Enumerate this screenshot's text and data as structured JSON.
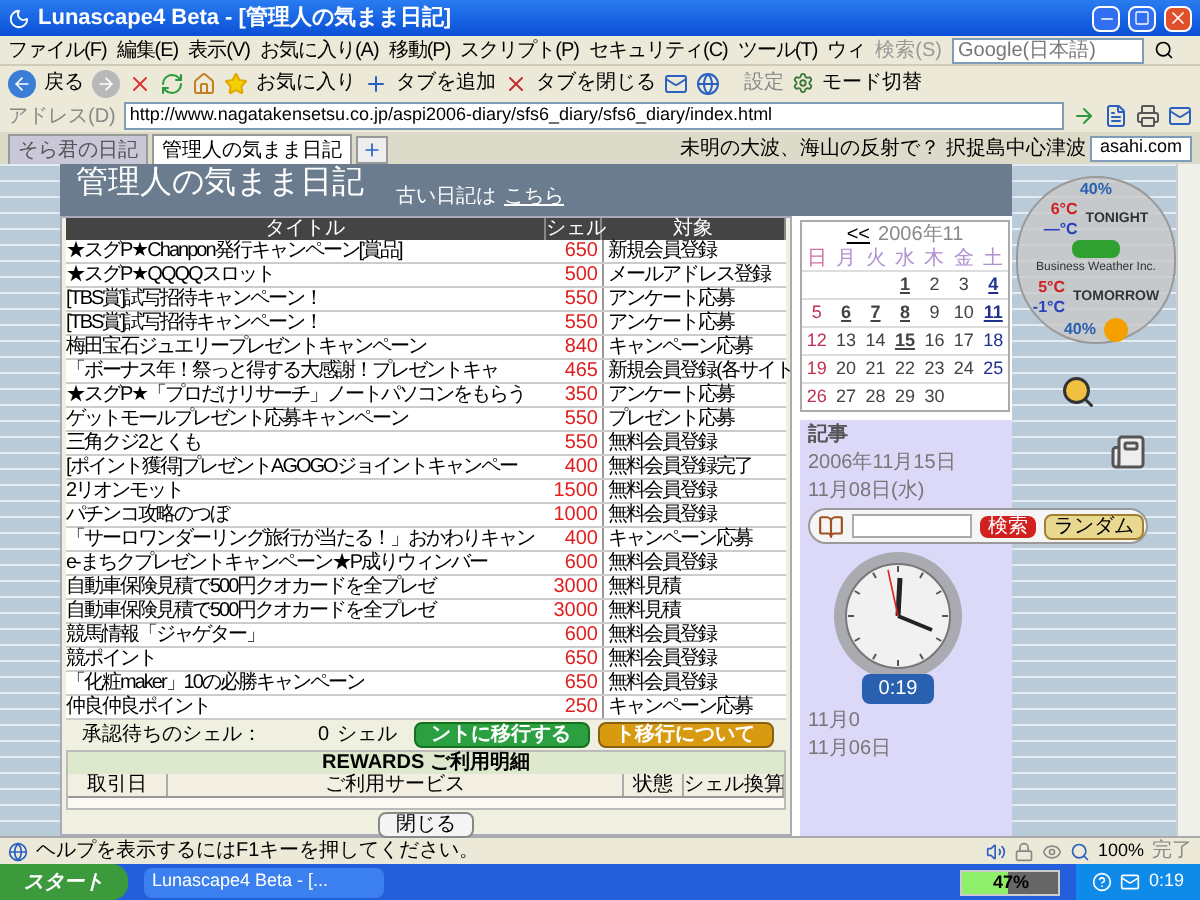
{
  "window": {
    "title": "Lunascape4 Beta - [管理人の気まま日記]"
  },
  "menu": [
    "ファイル(F)",
    "編集(E)",
    "表示(V)",
    "お気に入り(A)",
    "移動(P)",
    "スクリプト(P)",
    "セキュリティ(C)",
    "ツール(T)",
    "ウィ"
  ],
  "search": {
    "label": "検索(S)",
    "engine": "Google(日本語)"
  },
  "toolbar": {
    "back": "戻る",
    "favorites": "お気に入り",
    "add_tab": "タブを追加",
    "close_tab": "タブを閉じる",
    "settings": "設定",
    "mode": "モード切替"
  },
  "address": {
    "label": "アドレス(D)",
    "url": "http://www.nagatakensetsu.co.jp/aspi2006-diary/sfs6_diary/sfs6_diary/index.html"
  },
  "tabs": [
    {
      "label": "そら君の日記",
      "selected": false
    },
    {
      "label": "管理人の気まま日記",
      "selected": true
    }
  ],
  "news_ticker": {
    "text": "未明の大波、海山の反射で？ 択捉島中心津波",
    "source": "asahi.com"
  },
  "page": {
    "title": "管理人の気まま日記",
    "old_diary_label": "古い日記は",
    "old_diary_link": "こちら"
  },
  "campaigns": {
    "columns": [
      "タイトル",
      "シェル",
      "対象"
    ],
    "rows": [
      {
        "title": "★スグP★Chanpon発行キャンペーン[賞品]",
        "shell": "650",
        "target": "新規会員登録"
      },
      {
        "title": "★スグP★QQQQスロット",
        "shell": "500",
        "target": "メールアドレス登録"
      },
      {
        "title": "[TBS賞]試写招待キャンペーン！",
        "shell": "550",
        "target": "アンケート応募"
      },
      {
        "title": "[TBS賞]試写招待キャンペーン！",
        "shell": "550",
        "target": "アンケート応募"
      },
      {
        "title": "梅田宝石ジュエリープレゼントキャンペーン",
        "shell": "840",
        "target": "キャンペーン応募"
      },
      {
        "title": "「ボーナス年！祭っと得する大感謝！プレゼントキャ",
        "shell": "465",
        "target": "新規会員登録(各サイト"
      },
      {
        "title": "★スグP★「プロだけリサーチ」ノートパソコンをもらう",
        "shell": "350",
        "target": "アンケート応募"
      },
      {
        "title": "ゲットモールプレゼント応募キャンペーン",
        "shell": "550",
        "target": "プレゼント応募"
      },
      {
        "title": "三角クジ2とくも",
        "shell": "550",
        "target": "無料会員登録"
      },
      {
        "title": "[ポイント獲得]プレゼントAGOGOジョイントキャンペー",
        "shell": "400",
        "target": "無料会員登録完了"
      },
      {
        "title": "2リオンモット",
        "shell": "1500",
        "target": "無料会員登録"
      },
      {
        "title": "パチンコ攻略のつぼ",
        "shell": "1000",
        "target": "無料会員登録"
      },
      {
        "title": "「サーロワンダーリング旅行が当たる！」おかわりキャン",
        "shell": "400",
        "target": "キャンペーン応募"
      },
      {
        "title": "e-まちクプレゼントキャンペーン★P成りウィンバー",
        "shell": "600",
        "target": "無料会員登録"
      },
      {
        "title": "自動車保険見積で500円クオカードを全プレゼ",
        "shell": "3000",
        "target": "無料見積"
      },
      {
        "title": "自動車保険見積で500円クオカードを全プレゼ",
        "shell": "3000",
        "target": "無料見積"
      },
      {
        "title": "競馬情報「ジャゲター」",
        "shell": "600",
        "target": "無料会員登録"
      },
      {
        "title": "競ポイント",
        "shell": "650",
        "target": "無料会員登録"
      },
      {
        "title": "「化粧maker」10の必勝キャンペーン",
        "shell": "650",
        "target": "無料会員登録"
      },
      {
        "title": "仲良仲良ポイント",
        "shell": "250",
        "target": "キャンペーン応募"
      }
    ]
  },
  "points": {
    "pending_label": "承認待ちのシェル：",
    "pending_value": "0",
    "pending_unit": "シェル",
    "convert_button": "ントに移行する",
    "about_button": "ト移行について"
  },
  "rewards": {
    "title": "REWARDS ご利用明細",
    "columns": [
      "取引日",
      "ご利用サービス",
      "状態",
      "シェル換算"
    ],
    "close_button": "閉じる"
  },
  "calendar": {
    "prev": "<<",
    "month": "2006年11",
    "weekdays": [
      "日",
      "月",
      "火",
      "水",
      "木",
      "金",
      "土"
    ],
    "first_week_starts_midweek": true,
    "weeks": [
      {
        "days": [
          {
            "day": "1",
            "link": true
          },
          {
            "day": "2",
            "link": false
          },
          {
            "day": "3",
            "link": false
          },
          {
            "day": "4",
            "link": true
          }
        ]
      },
      {
        "days": [
          {
            "day": "5",
            "link": false
          },
          {
            "day": "6",
            "link": true
          },
          {
            "day": "7",
            "link": true
          },
          {
            "day": "8",
            "link": true
          },
          {
            "day": "9",
            "link": false
          },
          {
            "day": "10",
            "link": false
          },
          {
            "day": "11",
            "link": true
          }
        ]
      },
      {
        "days": [
          {
            "day": "12",
            "link": false
          },
          {
            "day": "13",
            "link": false
          },
          {
            "day": "14",
            "link": false
          },
          {
            "day": "15",
            "link": true
          },
          {
            "day": "16",
            "link": false
          },
          {
            "day": "17",
            "link": false
          },
          {
            "day": "18",
            "link": false
          }
        ]
      },
      {
        "days": [
          {
            "day": "19",
            "link": false
          },
          {
            "day": "20",
            "link": false
          },
          {
            "day": "21",
            "link": false
          },
          {
            "day": "22",
            "link": false
          },
          {
            "day": "23",
            "link": false
          },
          {
            "day": "24",
            "link": false
          },
          {
            "day": "25",
            "link": false
          }
        ]
      },
      {
        "days": [
          {
            "day": "26",
            "link": false
          },
          {
            "day": "27",
            "link": false
          },
          {
            "day": "28",
            "link": false
          },
          {
            "day": "29",
            "link": false
          },
          {
            "day": "30",
            "link": false
          }
        ]
      }
    ]
  },
  "weather": {
    "tonight": {
      "label": "TONIGHT",
      "rain": "40%",
      "high": "6°C",
      "low": "—°C"
    },
    "tomorrow": {
      "label": "TOMORROW",
      "rain": "40%",
      "high": "5°C",
      "low": "-1°C"
    },
    "credit": "Business Weather Inc."
  },
  "recent": {
    "title": "記事",
    "dates": [
      "2006年11月15日",
      "11月08日(水)",
      "11月0",
      "11月06日"
    ]
  },
  "search_widget": {
    "search_button": "検索",
    "random_button": "ランダム"
  },
  "clock": {
    "time": "0:19"
  },
  "status_bar": {
    "text": "ヘルプを表示するにはF1キーを押してください。",
    "zoom": "100%",
    "state": "完了"
  },
  "taskbar": {
    "start": "スタート",
    "task": "Lunascape4 Beta - [...",
    "battery": {
      "level": 0.47,
      "reading": "47%"
    },
    "time": "0:19"
  }
}
